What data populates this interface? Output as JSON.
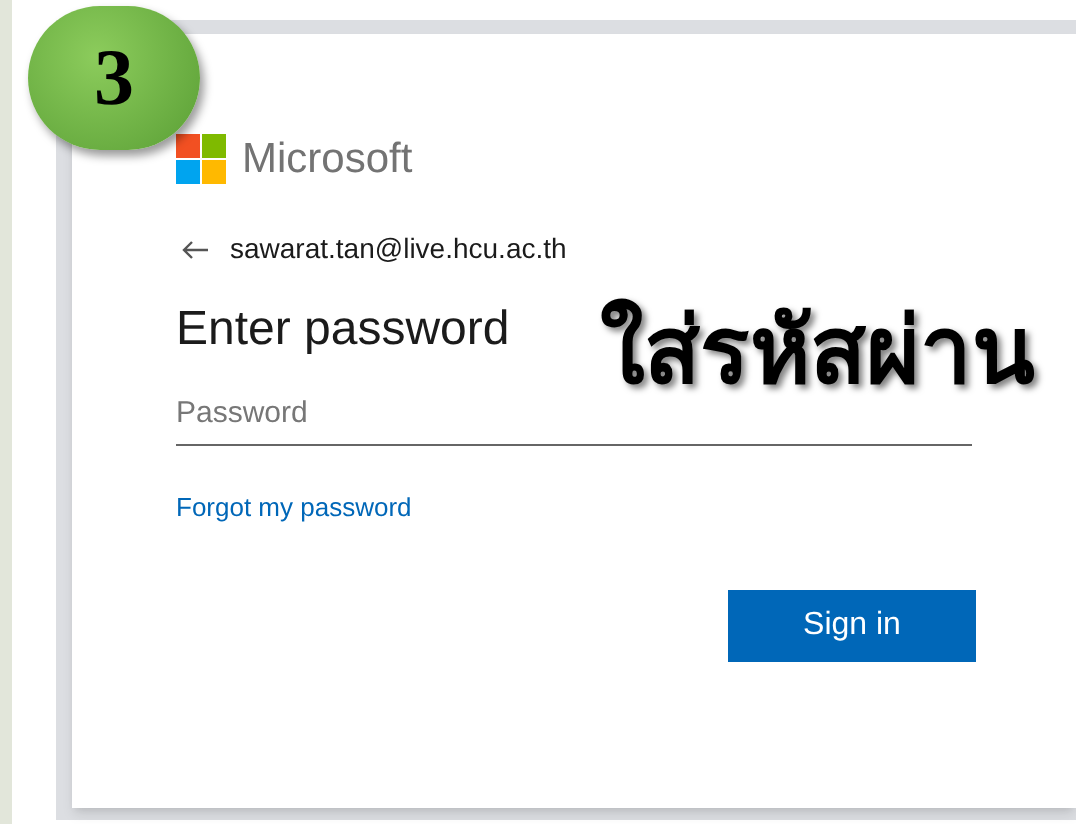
{
  "badge": {
    "number": "3"
  },
  "brand": {
    "name": "Microsoft"
  },
  "account": {
    "email": "sawarat.tan@live.hcu.ac.th"
  },
  "heading": "Enter password",
  "annotation": "ใส่รหัสผ่าน",
  "password_field": {
    "placeholder": "Password"
  },
  "forgot_link": "Forgot my password",
  "sign_in_button": "Sign in"
}
